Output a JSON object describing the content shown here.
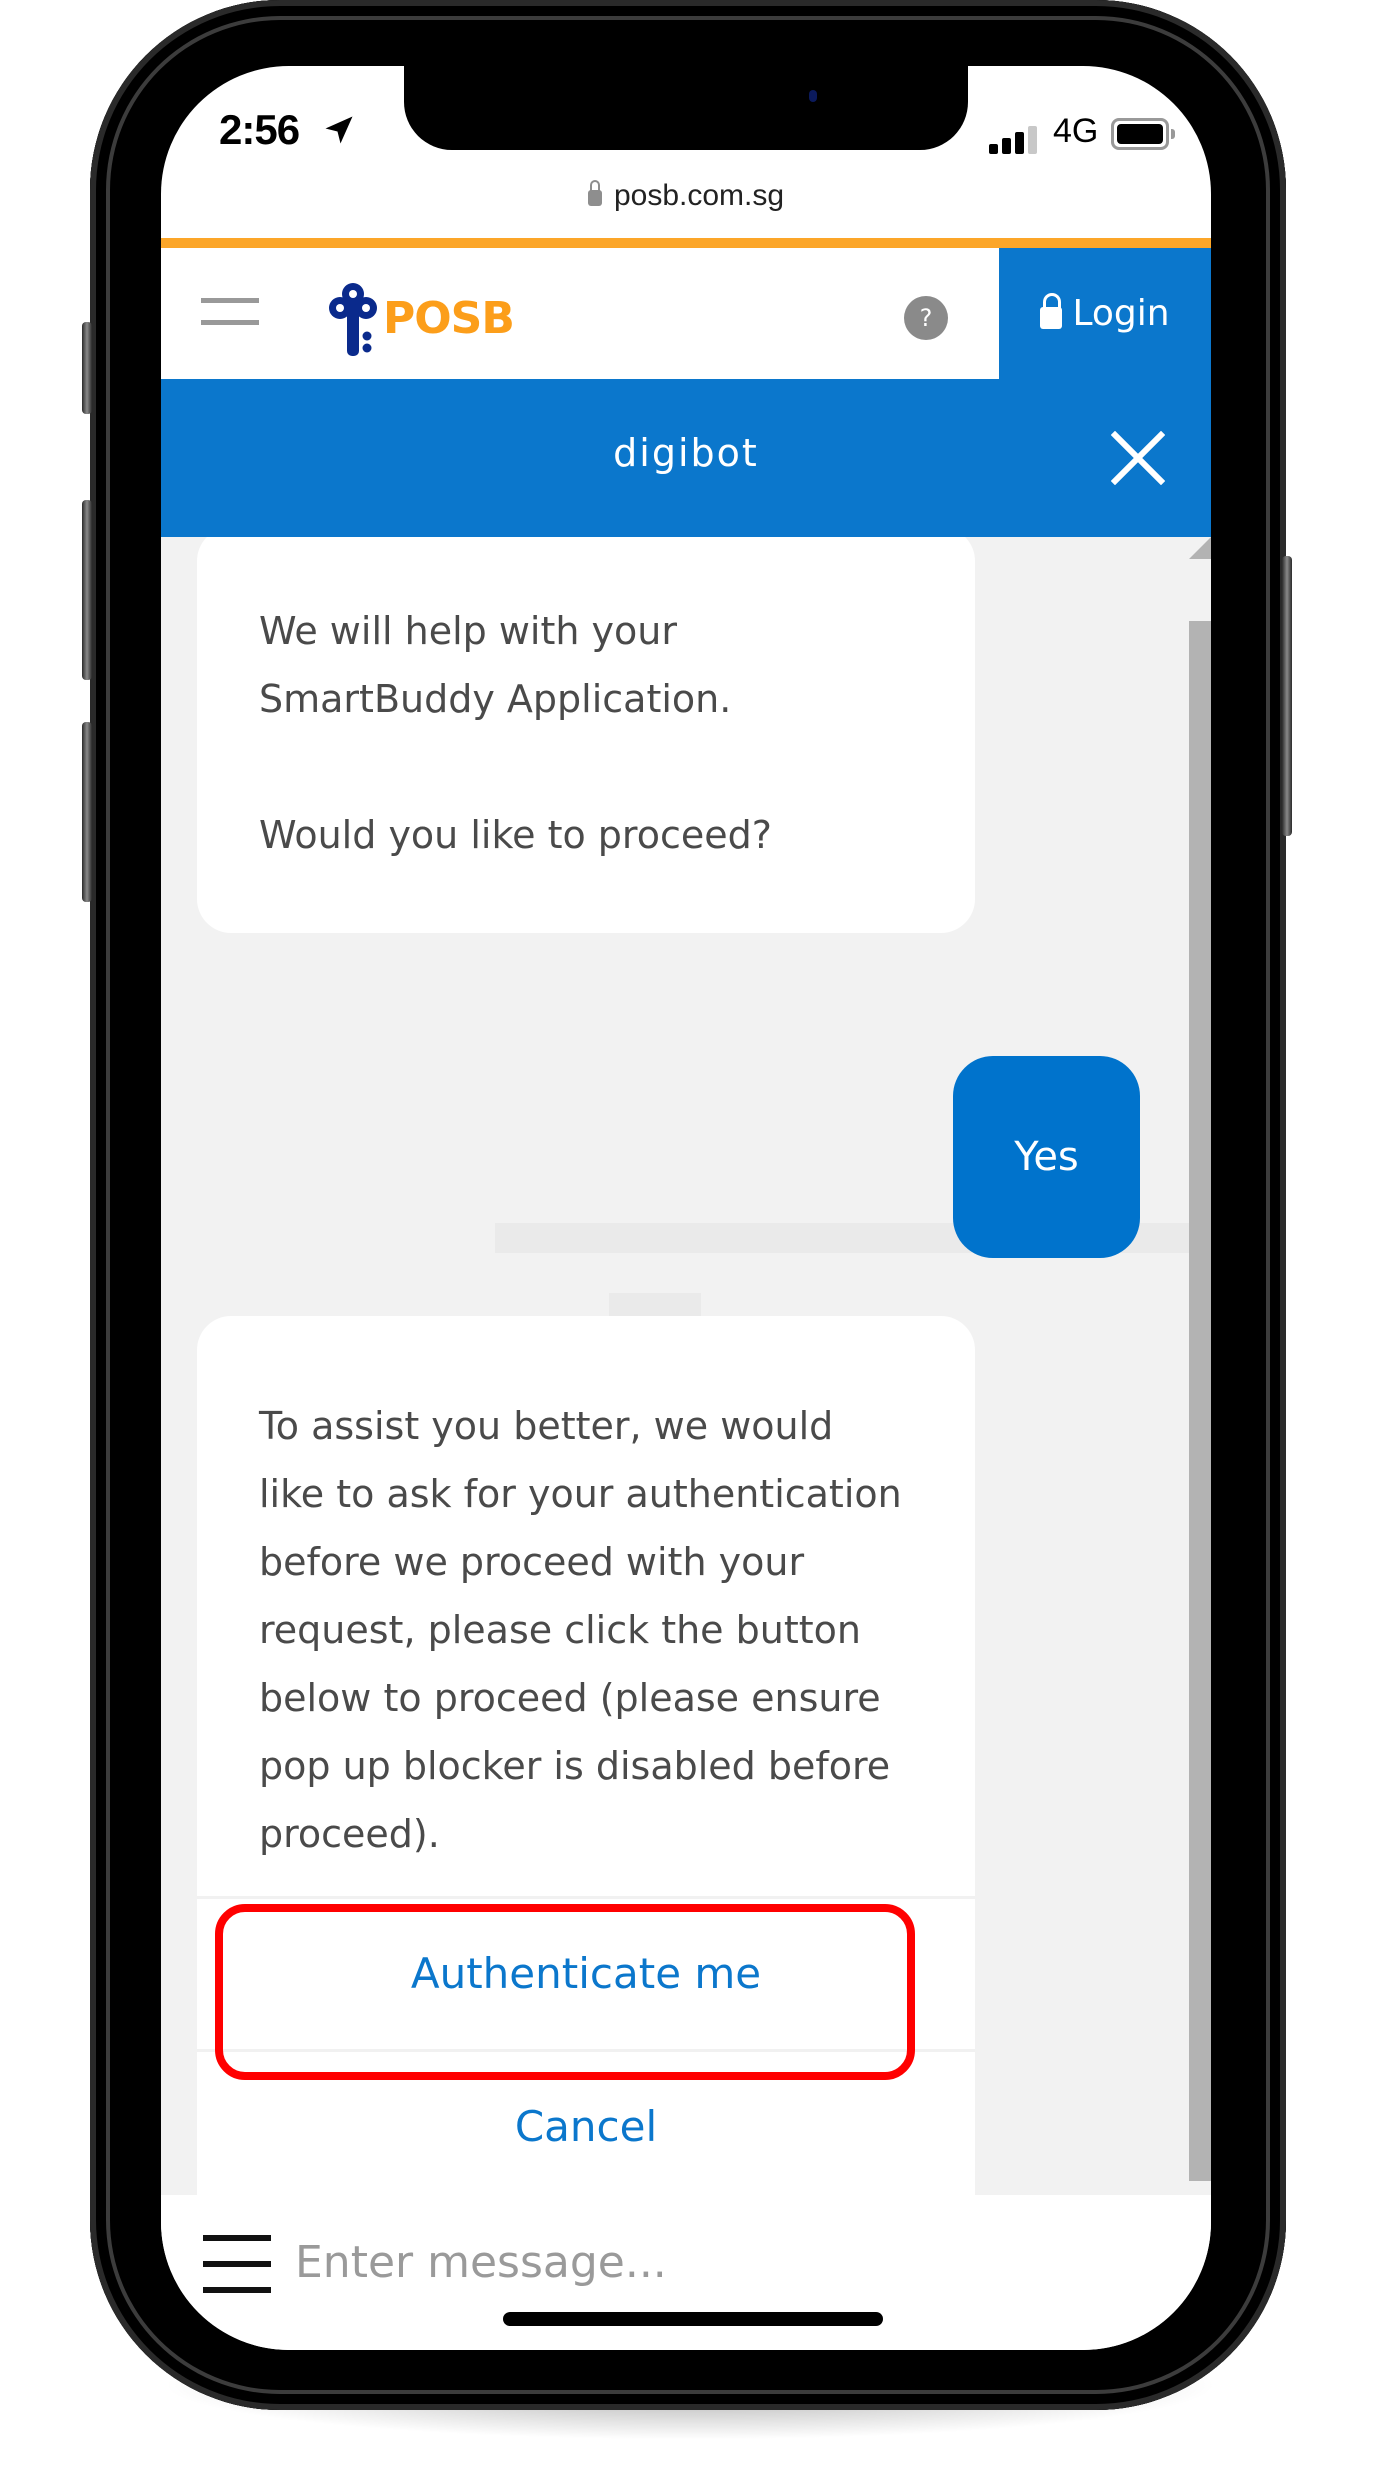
{
  "status_bar": {
    "time": "2:56",
    "network": "4G",
    "signal_bars_filled": 3,
    "signal_bars_total": 4
  },
  "browser": {
    "url": "posb.com.sg"
  },
  "site_header": {
    "brand": "POSB",
    "help_label": "?",
    "login_label": "Login",
    "colors": {
      "brand_orange": "#fc9e1a",
      "brand_navy": "#0a2a8c",
      "accent_blue": "#0b77cc"
    }
  },
  "chat": {
    "title": "digibot",
    "messages": [
      {
        "sender": "bot",
        "text": "We will help with your\nSmartBuddy Application.\n\nWould you like to proceed?"
      },
      {
        "sender": "user",
        "text": "Yes"
      },
      {
        "sender": "bot",
        "text": "To assist you better, we would\nlike to ask for your authentication\nbefore we proceed with your\nrequest, please click the button\nbelow to proceed (please ensure\npop up blocker is disabled before\nproceed).",
        "buttons": [
          "Authenticate me",
          "Cancel"
        ]
      }
    ],
    "input_placeholder": "Enter message..."
  }
}
